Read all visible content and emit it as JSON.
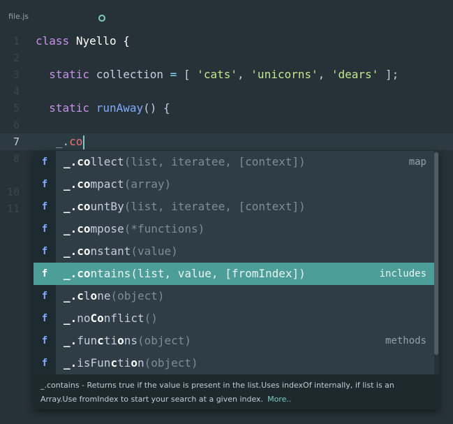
{
  "tab": {
    "filename": "file.js"
  },
  "lines": [
    {
      "num": "1"
    },
    {
      "num": "2"
    },
    {
      "num": "3"
    },
    {
      "num": "4"
    },
    {
      "num": "5"
    },
    {
      "num": "6"
    },
    {
      "num": "7"
    },
    {
      "num": "8"
    },
    {
      "num": "10"
    },
    {
      "num": "11"
    }
  ],
  "code": {
    "line1": {
      "kw": "class",
      "name": "Nyello",
      "brace": "{"
    },
    "line3": {
      "kw": "static",
      "prop": "collection",
      "eq": "=",
      "open": "[",
      "s1": "'cats'",
      "s2": "'unicorns'",
      "s3": "'dears'",
      "close": "];"
    },
    "line5": {
      "kw": "static",
      "fn": "runAway",
      "parens": "()",
      "brace": "{"
    },
    "line7": {
      "prefix": "_.",
      "typed": "co"
    }
  },
  "autocomplete": {
    "items": [
      {
        "badge": "f",
        "prefix": "_.",
        "hl": "co",
        "rest": "llect",
        "args": "(list, iteratee, [context])",
        "right": "map"
      },
      {
        "badge": "f",
        "prefix": "_.",
        "hl": "co",
        "rest": "mpact",
        "args": "(array)",
        "right": ""
      },
      {
        "badge": "f",
        "prefix": "_.",
        "hl": "co",
        "rest": "untBy",
        "args": "(list, iteratee, [context])",
        "right": ""
      },
      {
        "badge": "f",
        "prefix": "_.",
        "hl": "co",
        "rest": "mpose",
        "args": "(*functions)",
        "right": ""
      },
      {
        "badge": "f",
        "prefix": "_.",
        "hl": "co",
        "rest": "nstant",
        "args": "(value)",
        "right": ""
      },
      {
        "badge": "f",
        "prefix": "_.",
        "hl": "co",
        "rest": "ntains",
        "args": "(list, value, [fromIndex])",
        "right": "includes"
      },
      {
        "badge": "f",
        "prefix": "_.",
        "hl": "c",
        "rest": "l",
        "hl2": "o",
        "rest2": "ne",
        "args": "(object)",
        "right": ""
      },
      {
        "badge": "f",
        "prefix": "_.",
        "pre": "no",
        "hl": "Co",
        "rest": "nflict",
        "args": "()",
        "right": ""
      },
      {
        "badge": "f",
        "prefix": "_.",
        "pre": "fun",
        "hl": "c",
        "rest": "ti",
        "hl2": "o",
        "rest2": "ns",
        "args": "(object)",
        "right": "methods"
      },
      {
        "badge": "f",
        "prefix": "_.",
        "pre": "isFun",
        "hl": "c",
        "rest": "ti",
        "hl2": "o",
        "rest2": "n",
        "args": "(object)",
        "right": ""
      }
    ],
    "selected_index": 5,
    "description": "_.contains - Returns true if the value is present in the list.Uses indexOf internally, if list is an Array.Use fromIndex to start your search at a given index.",
    "more_label": "More.."
  }
}
